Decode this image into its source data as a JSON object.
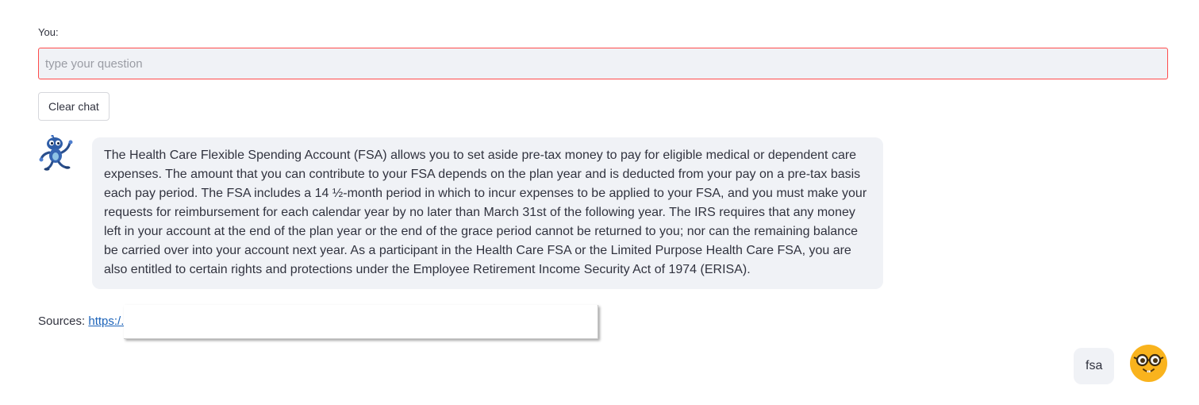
{
  "input": {
    "label": "You:",
    "placeholder": "type your question",
    "value": ""
  },
  "buttons": {
    "clear_chat": "Clear chat"
  },
  "chat": {
    "bot_message": "The Health Care Flexible Spending Account (FSA) allows you to set aside pre-tax money to pay for eligible medical or dependent care expenses. The amount that you can contribute to your FSA depends on the plan year and is deducted from your pay on a pre-tax basis each pay period. The FSA includes a 14 ½-month period in which to incur expenses to be applied to your FSA, and you must make your requests for reimbursement for each calendar year by no later than March 31st of the following year. The IRS requires that any money left in your account at the end of the plan year or the end of the grace period cannot be returned to you; nor can the remaining balance be carried over into your account next year. As a participant in the Health Care FSA or the Limited Purpose Health Care FSA, you are also entitled to certain rights and protections under the Employee Retirement Income Security Act of 1974 (ERISA).",
    "sources_label": "Sources:",
    "sources_link": "https:/.",
    "user_message": "fsa"
  },
  "icons": {
    "bot_avatar": "robot-icon",
    "user_avatar": "nerd-face-icon"
  },
  "colors": {
    "input_border": "#ff4b4b",
    "bubble_bg": "#f0f2f6",
    "link": "#1c63b9",
    "user_avatar": "#f9b31d"
  }
}
